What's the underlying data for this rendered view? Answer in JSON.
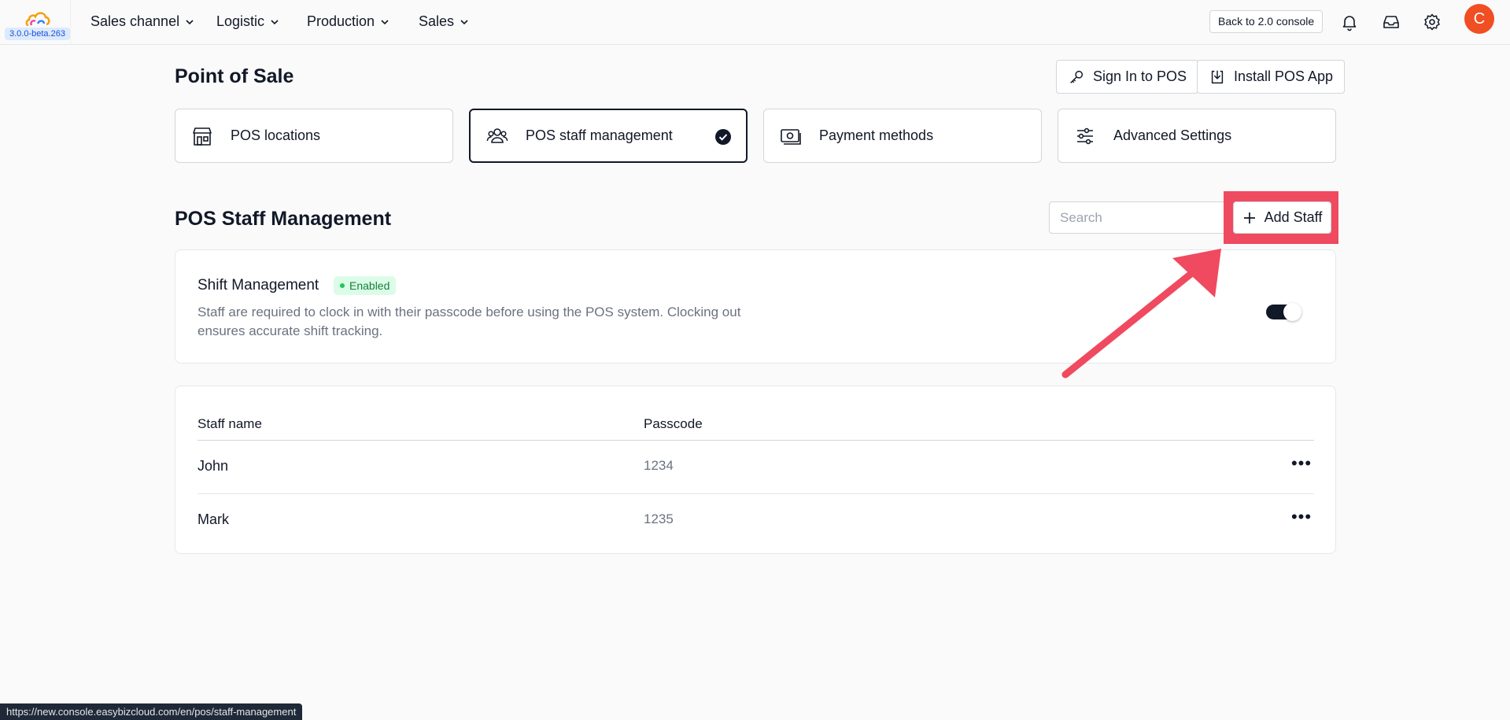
{
  "app": {
    "version": "3.0.0-beta.263"
  },
  "nav": {
    "items": [
      {
        "label": "Sales channel"
      },
      {
        "label": "Logistic"
      },
      {
        "label": "Production"
      },
      {
        "label": "Sales"
      }
    ],
    "back_label": "Back to 2.0 console",
    "avatar_initial": "C"
  },
  "page": {
    "title": "Point of Sale",
    "sign_in_label": "Sign In to POS",
    "install_label": "Install POS App"
  },
  "cards": [
    {
      "label": "POS locations",
      "icon": "store-icon",
      "active": false
    },
    {
      "label": "POS staff management",
      "icon": "users-icon",
      "active": true
    },
    {
      "label": "Payment methods",
      "icon": "money-icon",
      "active": false
    },
    {
      "label": "Advanced Settings",
      "icon": "sliders-icon",
      "active": false
    }
  ],
  "section": {
    "title": "POS Staff Management",
    "search_placeholder": "Search",
    "add_label": "Add Staff"
  },
  "shift": {
    "title": "Shift Management",
    "status": "Enabled",
    "description": "Staff are required to clock in with their passcode before using the POS system. Clocking out ensures accurate shift tracking.",
    "enabled": true
  },
  "table": {
    "headers": [
      "Staff name",
      "Passcode"
    ],
    "rows": [
      {
        "name": "John",
        "passcode": "1234"
      },
      {
        "name": "Mark",
        "passcode": "1235"
      }
    ]
  },
  "status_bar": {
    "url": "https://new.console.easybizcloud.com/en/pos/staff-management"
  },
  "colors": {
    "highlight": "#ef4a5f",
    "avatar": "#f04e23",
    "enabled_bg": "#dcfce7",
    "enabled_text": "#15803d"
  }
}
